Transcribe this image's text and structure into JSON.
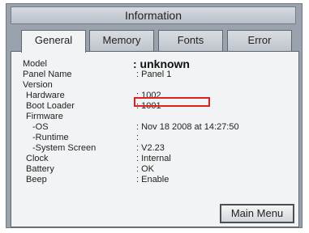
{
  "window": {
    "title": "Information"
  },
  "tabs": [
    {
      "label": "General"
    },
    {
      "label": "Memory"
    },
    {
      "label": "Fonts"
    },
    {
      "label": "Error"
    }
  ],
  "rows": [
    {
      "label": "Model",
      "value": ": unknown"
    },
    {
      "label": "Panel Name",
      "value": ": Panel 1"
    },
    {
      "label": "Version",
      "value": ""
    },
    {
      "label": "Hardware",
      "value": ": 1002"
    },
    {
      "label": "Boot Loader",
      "value": ": 1001"
    },
    {
      "label": "Firmware",
      "value": ""
    },
    {
      "label": "-OS",
      "value": ": Nov 18 2008 at 14:27:50"
    },
    {
      "label": "-Runtime",
      "value": ":"
    },
    {
      "label": "-System Screen",
      "value": ": V2.23"
    },
    {
      "label": "Clock",
      "value": ": Internal"
    },
    {
      "label": "Battery",
      "value": ": OK"
    },
    {
      "label": "Beep",
      "value": ": Enable"
    }
  ],
  "buttons": {
    "main_menu": "Main Menu"
  },
  "colors": {
    "highlight_box": "#e02020"
  }
}
